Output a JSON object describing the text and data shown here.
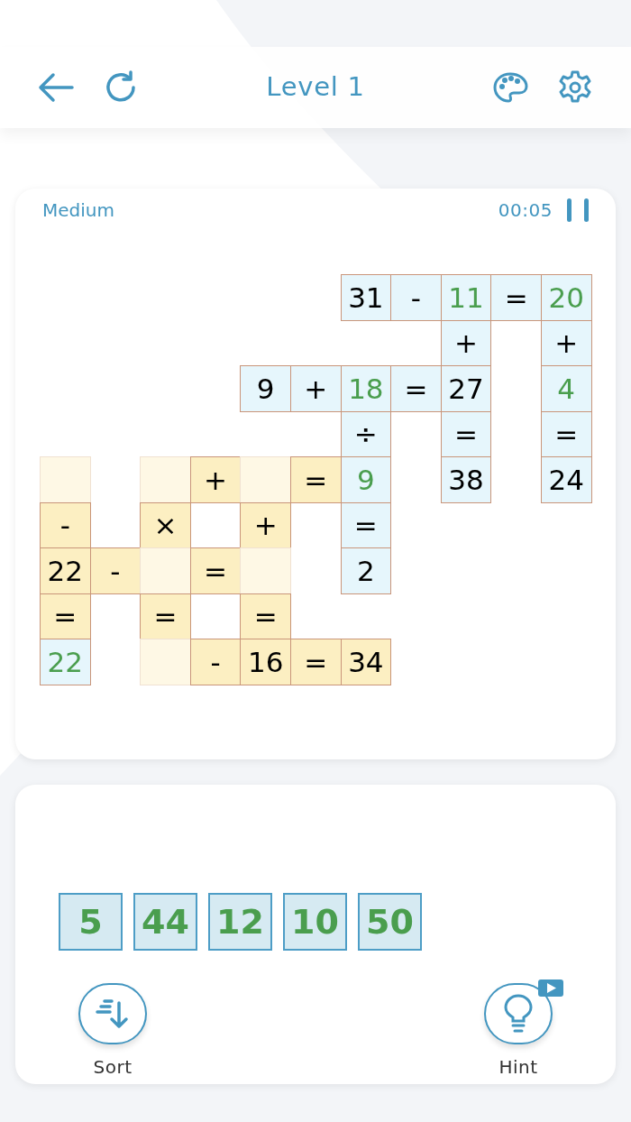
{
  "header": {
    "title": "Level 1"
  },
  "board": {
    "difficulty": "Medium",
    "timer": "00:05",
    "rows": [
      {
        "cells": [
          {
            "kind": "gap"
          },
          {
            "kind": "gap"
          },
          {
            "kind": "gap"
          },
          {
            "kind": "gap"
          },
          {
            "kind": "gap"
          },
          {
            "kind": "gap"
          },
          {
            "kind": "given",
            "text": "31",
            "placed": false
          },
          {
            "kind": "given",
            "text": "-",
            "placed": false
          },
          {
            "kind": "given",
            "text": "11",
            "placed": true
          },
          {
            "kind": "given",
            "text": "=",
            "placed": false
          },
          {
            "kind": "given",
            "text": "20",
            "placed": true
          }
        ]
      },
      {
        "cells": [
          {
            "kind": "gap"
          },
          {
            "kind": "gap"
          },
          {
            "kind": "gap"
          },
          {
            "kind": "gap"
          },
          {
            "kind": "gap"
          },
          {
            "kind": "gap"
          },
          {
            "kind": "gap"
          },
          {
            "kind": "gap"
          },
          {
            "kind": "given",
            "text": "+",
            "placed": false
          },
          {
            "kind": "gap"
          },
          {
            "kind": "given",
            "text": "+",
            "placed": false
          }
        ]
      },
      {
        "cells": [
          {
            "kind": "gap"
          },
          {
            "kind": "gap"
          },
          {
            "kind": "gap"
          },
          {
            "kind": "gap"
          },
          {
            "kind": "given",
            "text": "9",
            "placed": false
          },
          {
            "kind": "given",
            "text": "+",
            "placed": false
          },
          {
            "kind": "given",
            "text": "18",
            "placed": true
          },
          {
            "kind": "given",
            "text": "=",
            "placed": false
          },
          {
            "kind": "given",
            "text": "27",
            "placed": false
          },
          {
            "kind": "gap"
          },
          {
            "kind": "given",
            "text": "4",
            "placed": true
          }
        ]
      },
      {
        "cells": [
          {
            "kind": "gap"
          },
          {
            "kind": "gap"
          },
          {
            "kind": "gap"
          },
          {
            "kind": "gap"
          },
          {
            "kind": "gap"
          },
          {
            "kind": "gap"
          },
          {
            "kind": "given",
            "text": "÷",
            "placed": false
          },
          {
            "kind": "gap"
          },
          {
            "kind": "given",
            "text": "=",
            "placed": false
          },
          {
            "kind": "gap"
          },
          {
            "kind": "given",
            "text": "=",
            "placed": false
          }
        ]
      },
      {
        "cells": [
          {
            "kind": "slot"
          },
          {
            "kind": "gap"
          },
          {
            "kind": "slot"
          },
          {
            "kind": "clue",
            "text": "+",
            "placed": false
          },
          {
            "kind": "slot"
          },
          {
            "kind": "clue",
            "text": "=",
            "placed": false
          },
          {
            "kind": "given",
            "text": "9",
            "placed": true
          },
          {
            "kind": "gap"
          },
          {
            "kind": "given",
            "text": "38",
            "placed": false
          },
          {
            "kind": "gap"
          },
          {
            "kind": "given",
            "text": "24",
            "placed": false
          }
        ]
      },
      {
        "cells": [
          {
            "kind": "clue",
            "text": "-",
            "placed": false
          },
          {
            "kind": "gap"
          },
          {
            "kind": "clue",
            "text": "×",
            "placed": false
          },
          {
            "kind": "gap"
          },
          {
            "kind": "clue",
            "text": "+",
            "placed": false
          },
          {
            "kind": "gap"
          },
          {
            "kind": "given",
            "text": "=",
            "placed": false
          },
          {
            "kind": "gap"
          },
          {
            "kind": "gap"
          },
          {
            "kind": "gap"
          },
          {
            "kind": "gap"
          }
        ]
      },
      {
        "cells": [
          {
            "kind": "clue",
            "text": "22",
            "placed": false
          },
          {
            "kind": "clue",
            "text": "-",
            "placed": false
          },
          {
            "kind": "slot"
          },
          {
            "kind": "clue",
            "text": "=",
            "placed": false
          },
          {
            "kind": "slot"
          },
          {
            "kind": "gap"
          },
          {
            "kind": "given",
            "text": "2",
            "placed": false
          },
          {
            "kind": "gap"
          },
          {
            "kind": "gap"
          },
          {
            "kind": "gap"
          },
          {
            "kind": "gap"
          }
        ]
      },
      {
        "cells": [
          {
            "kind": "clue",
            "text": "=",
            "placed": false
          },
          {
            "kind": "gap"
          },
          {
            "kind": "clue",
            "text": "=",
            "placed": false
          },
          {
            "kind": "gap"
          },
          {
            "kind": "clue",
            "text": "=",
            "placed": false
          },
          {
            "kind": "gap"
          },
          {
            "kind": "gap"
          },
          {
            "kind": "gap"
          },
          {
            "kind": "gap"
          },
          {
            "kind": "gap"
          },
          {
            "kind": "gap"
          }
        ]
      },
      {
        "cells": [
          {
            "kind": "given",
            "text": "22",
            "placed": true
          },
          {
            "kind": "gap"
          },
          {
            "kind": "slot"
          },
          {
            "kind": "clue",
            "text": "-",
            "placed": false
          },
          {
            "kind": "clue",
            "text": "16",
            "placed": false
          },
          {
            "kind": "clue",
            "text": "=",
            "placed": false
          },
          {
            "kind": "clue",
            "text": "34",
            "placed": false
          },
          {
            "kind": "gap"
          },
          {
            "kind": "gap"
          },
          {
            "kind": "gap"
          },
          {
            "kind": "gap"
          }
        ]
      }
    ]
  },
  "tray": {
    "tiles": [
      "5",
      "44",
      "12",
      "10",
      "50"
    ],
    "actions": [
      {
        "kind": "sort",
        "label": "Sort"
      },
      {
        "kind": "hint",
        "label": "Hint"
      }
    ]
  }
}
